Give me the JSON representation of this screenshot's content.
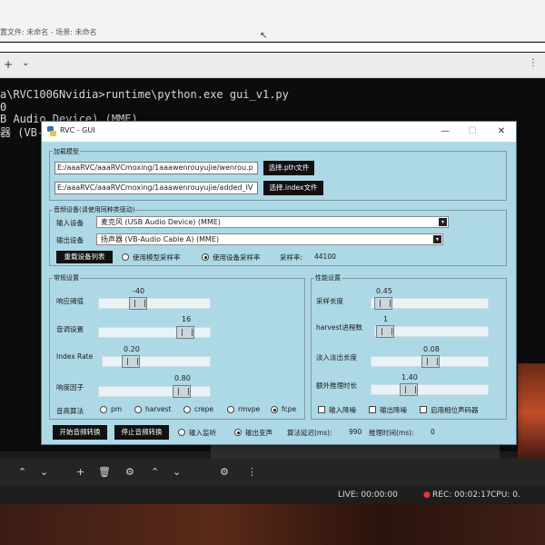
{
  "obs": {
    "title_fragment": "置文件: 未命名 - 场景: 未命名",
    "status_live": "LIVE: 00:00:00",
    "status_rec": "REC: 00:02:17",
    "status_cpu": "CPU: 0."
  },
  "console": {
    "lines": [
      "a\\RVC1006Nvidia>runtime\\python.exe gui_v1.py",
      "0",
      "B Audio Device) (MME)",
      "器 (VB-"
    ]
  },
  "window": {
    "title": "RVC - GUI",
    "minimize": "—",
    "maximize": "☐",
    "close": "✕"
  },
  "model": {
    "group_label": "加载模型",
    "pth_path": "E:/aaaRVC/aaaRVCmoxing/1aaawenrouyujie/wenrou.p",
    "pth_button": "选择.pth文件",
    "index_path": "E:/aaaRVC/aaaRVCmoxing/1aaawenrouyujie/added_IV",
    "index_button": "选择.index文件"
  },
  "device": {
    "group_label": "音频设备(请使用同种类驱动)",
    "input_label": "输入设备",
    "input_value": "麦克风 (USB Audio Device) (MME)",
    "output_label": "输出设备",
    "output_value": "扬声器 (VB-Audio Cable A) (MME)",
    "reload_button": "重载设备列表",
    "radio_model_sr": "使用模型采样率",
    "radio_device_sr": "使用设备采样率",
    "sr_label": "采样率:",
    "sr_value": "44100"
  },
  "general": {
    "group_label": "常规设置",
    "threshold_label": "响应阈值",
    "threshold_value": "-40",
    "pitch_label": "音调设置",
    "pitch_value": "16",
    "index_rate_label": "Index Rate",
    "index_rate_value": "0.20",
    "rms_label": "响度因子",
    "rms_value": "0.80",
    "f0_label": "音高算法",
    "f0_options": [
      "pm",
      "harvest",
      "crepe",
      "rmvpe",
      "fcpe"
    ]
  },
  "perf": {
    "group_label": "性能设置",
    "block_label": "采样长度",
    "block_value": "0.45",
    "harvest_label": "harvest进程数",
    "harvest_value": "1",
    "crossfade_label": "淡入淡出长度",
    "crossfade_value": "0.08",
    "extra_label": "额外推理时长",
    "extra_value": "1.40",
    "chk_input_denoise": "输入降噪",
    "chk_output_denoise": "输出降噪",
    "chk_phase_vocoder": "启用相位声码器"
  },
  "bottom": {
    "start_button": "开始音频转换",
    "stop_button": "停止音频转换",
    "radio_input_monitor": "输入监听",
    "radio_output_voice": "输出变声",
    "latency_label": "算法延迟(ms):",
    "latency_value": "990",
    "infer_label": "推理时间(ms):",
    "infer_value": "0"
  },
  "colors": {
    "window_bg": "#add8e6",
    "button_bg": "#111111"
  }
}
